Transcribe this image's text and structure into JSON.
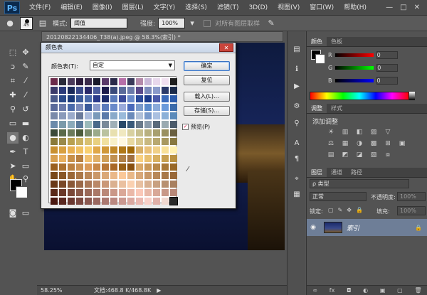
{
  "app": {
    "logo": "Ps"
  },
  "menu": [
    "文件(F)",
    "编辑(E)",
    "图像(I)",
    "图层(L)",
    "文字(Y)",
    "选择(S)",
    "滤镜(T)",
    "3D(D)",
    "视图(V)",
    "窗口(W)",
    "帮助(H)"
  ],
  "window_controls": [
    "—",
    "□",
    "✕"
  ],
  "options": {
    "brush_size": "45",
    "mode_label": "模式:",
    "mode_value": "阈值",
    "strength_label": "强度:",
    "strength_value": "100%",
    "sample_all_label": "对所有图层取样"
  },
  "document": {
    "tab_title": "20120822134406_T38(a).jpeg @ 58.3%(索引) *",
    "zoom": "58.25%",
    "doc_info": "文档:468.8 K/468.8K"
  },
  "dialog": {
    "title": "颜色表",
    "close": "✕",
    "table_label": "颜色表(T):",
    "table_value": "自定",
    "ok": "确定",
    "reset": "复位",
    "load": "载入(L)...",
    "save": "存储(S)...",
    "preview": "预览(P)",
    "preview_checked": "✓",
    "swatches": [
      "#6b2a4a",
      "#2a2a3a",
      "#4a3a5a",
      "#2a1a3a",
      "#3a2a4a",
      "#1a1a2a",
      "#5a3a6a",
      "#2a2a4a",
      "#b66fa8",
      "#3a3a5a",
      "#b48aaa",
      "#c9b8d8",
      "#e8d8ec",
      "#f0e0f0",
      "#1e1e1e",
      "#3a3a6a",
      "#2a3a7a",
      "#1a2a5a",
      "#3a4a8a",
      "#2a2a6a",
      "#4a5a9a",
      "#1a1a4a",
      "#3a4a7a",
      "#5a6a9a",
      "#6a7aaa",
      "#5a4a8a",
      "#7a8aba",
      "#8a9aca",
      "#2a3a6a",
      "#1a2a4a",
      "#4a5a8a",
      "#2a4a8a",
      "#1a3a7a",
      "#3a5a9a",
      "#4a6aaa",
      "#2a3a8a",
      "#1a2a6a",
      "#5a7aba",
      "#3a4a9a",
      "#6a8aca",
      "#2a4a9a",
      "#1a3a8a",
      "#4a5aaa",
      "#3a6aba",
      "#2a5aaa",
      "#5a6a9a",
      "#6a7aaa",
      "#4a6aaa",
      "#7a8aba",
      "#3a5a9a",
      "#8a9aca",
      "#5a7aba",
      "#6a8aca",
      "#9aaada",
      "#4a6aba",
      "#7a9aca",
      "#5a8aca",
      "#8aaada",
      "#6a9ada",
      "#3a6aaa",
      "#7a8aaa",
      "#8a9aba",
      "#9aaaca",
      "#6a7a9a",
      "#aabada",
      "#7a9aba",
      "#5a7aaa",
      "#8aaaca",
      "#9abada",
      "#6a8aba",
      "#b0c0d8",
      "#7a9aca",
      "#aac0e0",
      "#8ab0d8",
      "#5a8aba",
      "#6a8aaa",
      "#7a9aaa",
      "#8aaaba",
      "#5a7a9a",
      "#9ababa",
      "#4a6a8a",
      "#7a8a9a",
      "#a0b0b8",
      "#2a4a6a",
      "#3a5a7a",
      "#6a7a8a",
      "#8a9aaa",
      "#5a6a7a",
      "#9aaab0",
      "#4a5a6a",
      "#3a4a3a",
      "#5a6a4a",
      "#6a7a5a",
      "#4a5a3a",
      "#7a8a6a",
      "#9aaa8a",
      "#bac2a0",
      "#e8e0b0",
      "#f0e8c0",
      "#d8d0a0",
      "#c8c090",
      "#b8b080",
      "#a8a070",
      "#9a9060",
      "#6a6040",
      "#8a7a3a",
      "#9a8a4a",
      "#b8a050",
      "#c8b060",
      "#d8c070",
      "#e8d080",
      "#f0e0a0",
      "#f8f0c8",
      "#fff8e0",
      "#e8d8a0",
      "#d8c890",
      "#c8b880",
      "#b8a870",
      "#a89860",
      "#887840",
      "#c89030",
      "#d8a040",
      "#e8b050",
      "#f0c060",
      "#f8d070",
      "#e0a848",
      "#d09838",
      "#c08828",
      "#b07818",
      "#a06808",
      "#d8b068",
      "#e8c078",
      "#f0d088",
      "#f8e098",
      "#fff0b0",
      "#d8a050",
      "#e8b060",
      "#c89048",
      "#b88040",
      "#f0c070",
      "#e0b068",
      "#d0a058",
      "#c09050",
      "#b08048",
      "#a07040",
      "#f8d080",
      "#e8c070",
      "#d8b060",
      "#c8a050",
      "#b89040",
      "#9a6020",
      "#aa7030",
      "#ba8040",
      "#ca9050",
      "#da9a58",
      "#c88848",
      "#b87838",
      "#a86828",
      "#986018",
      "#885010",
      "#d8a868",
      "#c89858",
      "#b88848",
      "#a87838",
      "#986828",
      "#7a4818",
      "#8a5828",
      "#9a6838",
      "#aa7848",
      "#ba8858",
      "#ca9868",
      "#daa878",
      "#eab888",
      "#fac898",
      "#e8b888",
      "#d8a878",
      "#c89868",
      "#b88858",
      "#a87848",
      "#986838",
      "#6a3818",
      "#7a4828",
      "#8a5838",
      "#9a6848",
      "#aa7858",
      "#ba8868",
      "#ca9878",
      "#dab090",
      "#eac0a0",
      "#fad0b0",
      "#e8c0a0",
      "#d8b090",
      "#c8a080",
      "#b89070",
      "#a88060",
      "#5a2818",
      "#6a3828",
      "#7a4838",
      "#8a5848",
      "#9a6858",
      "#aa7868",
      "#ba8878",
      "#ca9888",
      "#daa898",
      "#eab8a8",
      "#fac8b8",
      "#e8b8a8",
      "#d8a898",
      "#c89888",
      "#b88878",
      "#4a1810",
      "#5a2820",
      "#6a3830",
      "#7a4840",
      "#8a5850",
      "#9a6860",
      "#aa7870",
      "#ba8880",
      "#ca9890",
      "#daa8a0",
      "#eab8b0",
      "#f8d0c8",
      "#e0b0a8",
      "#f0d8d0",
      "#2a2a2a"
    ]
  },
  "color_panel": {
    "tabs": [
      "颜色",
      "色板"
    ],
    "rows": [
      {
        "label": "R",
        "value": "0"
      },
      {
        "label": "G",
        "value": "0"
      },
      {
        "label": "B",
        "value": "0"
      }
    ]
  },
  "adjust_panel": {
    "tabs": [
      "调整",
      "样式"
    ],
    "title": "添加调整",
    "icons": [
      "☀",
      "▥",
      "◧",
      "▨",
      "▽",
      "⚖",
      "▦",
      "◑",
      "▩",
      "⊞",
      "▣",
      "▤",
      "◩",
      "◪",
      "▧",
      "⧈"
    ]
  },
  "layers_panel": {
    "tabs": [
      "图层",
      "通道",
      "路径"
    ],
    "filter_label": "ρ 类型",
    "blend_mode": "正常",
    "opacity_label": "不透明度:",
    "opacity_value": "100%",
    "lock_label": "锁定:",
    "fill_label": "填充:",
    "fill_value": "100%",
    "layer_name": "索引",
    "layer_eye": "◉",
    "layer_lock": "🔒",
    "footer_icons": [
      "∞",
      "fx",
      "◘",
      "◐",
      "▣",
      "▢",
      "🗑"
    ]
  },
  "colors": {
    "accent": "#3a73c4",
    "layer_selected": "#6e7e97"
  }
}
